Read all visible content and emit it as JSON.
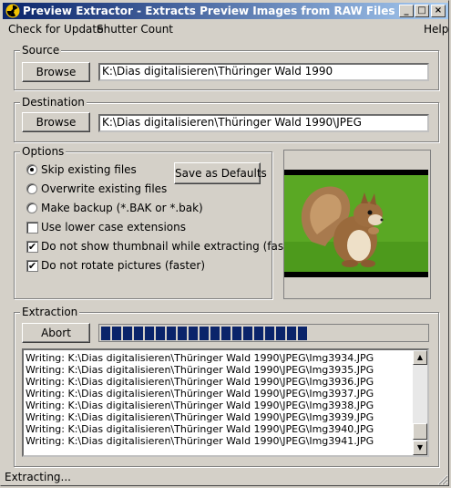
{
  "window": {
    "title": "Preview Extractor - Extracts Preview Images from RAW Files",
    "minimize_label": "_",
    "maximize_label": "□",
    "close_label": "×",
    "titlebar_color_start": "#0a246a",
    "titlebar_color_end": "#a6caf0"
  },
  "menu": {
    "check_update": "Check for Update",
    "shutter_count": "Shutter Count",
    "help": "Help"
  },
  "source": {
    "label": "Source",
    "browse_label": "Browse",
    "path": "K:\\Dias digitalisieren\\Thüringer Wald 1990"
  },
  "destination": {
    "label": "Destination",
    "browse_label": "Browse",
    "path": "K:\\Dias digitalisieren\\Thüringer Wald 1990\\JPEG"
  },
  "options": {
    "label": "Options",
    "save_defaults_label": "Save as Defaults",
    "radio_skip": "Skip existing files",
    "radio_overwrite": "Overwrite existing files",
    "radio_backup": "Make backup (*.BAK or *.bak)",
    "selected_radio": "skip",
    "check_lowercase": "Use lower case extensions",
    "check_lowercase_checked": false,
    "check_no_thumbnail": "Do not show thumbnail while extracting (faster)",
    "check_no_thumbnail_checked": true,
    "check_no_rotate": "Do not rotate pictures (faster)",
    "check_no_rotate_checked": true
  },
  "extraction": {
    "label": "Extraction",
    "abort_label": "Abort",
    "progress_fraction": 0.66,
    "progress_color": "#0a246a",
    "log": [
      "Writing: K:\\Dias digitalisieren\\Thüringer Wald 1990\\JPEG\\Img3934.JPG",
      "Writing: K:\\Dias digitalisieren\\Thüringer Wald 1990\\JPEG\\Img3935.JPG",
      "Writing: K:\\Dias digitalisieren\\Thüringer Wald 1990\\JPEG\\Img3936.JPG",
      "Writing: K:\\Dias digitalisieren\\Thüringer Wald 1990\\JPEG\\Img3937.JPG",
      "Writing: K:\\Dias digitalisieren\\Thüringer Wald 1990\\JPEG\\Img3938.JPG",
      "Writing: K:\\Dias digitalisieren\\Thüringer Wald 1990\\JPEG\\Img3939.JPG",
      "Writing: K:\\Dias digitalisieren\\Thüringer Wald 1990\\JPEG\\Img3940.JPG",
      "Writing: K:\\Dias digitalisieren\\Thüringer Wald 1990\\JPEG\\Img3941.JPG"
    ]
  },
  "status": {
    "text": "Extracting..."
  },
  "icons": {
    "app": "radiation-icon",
    "scroll_up": "arrow-up-icon",
    "scroll_down": "arrow-down-icon"
  }
}
